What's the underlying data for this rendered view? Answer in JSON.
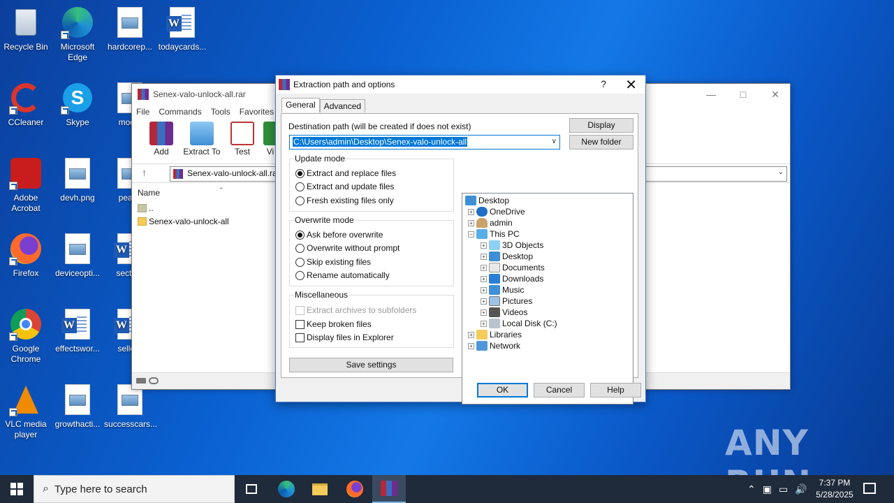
{
  "desktop": {
    "icons": [
      {
        "label": "Recycle Bin"
      },
      {
        "label": "Microsoft Edge"
      },
      {
        "label": "hardcorep..."
      },
      {
        "label": "todaycards..."
      },
      {
        "label": "CCleaner"
      },
      {
        "label": "Skype"
      },
      {
        "label": "modul"
      },
      {
        "label": "Adobe Acrobat"
      },
      {
        "label": "devh.png"
      },
      {
        "label": "peace"
      },
      {
        "label": "Firefox"
      },
      {
        "label": "deviceopti..."
      },
      {
        "label": "sectore"
      },
      {
        "label": "Google Chrome"
      },
      {
        "label": "effectswor..."
      },
      {
        "label": "sellera"
      },
      {
        "label": "VLC media player"
      },
      {
        "label": "growthacti..."
      },
      {
        "label": "successcars..."
      }
    ]
  },
  "winrar": {
    "title": "Senex-valo-unlock-all.rar",
    "menu": [
      "File",
      "Commands",
      "Tools",
      "Favorites"
    ],
    "toolbar": [
      "Add",
      "Extract To",
      "Test",
      "Vi"
    ],
    "address": "Senex-valo-unlock-all.ra",
    "column_name": "Name",
    "rows": [
      "..",
      "Senex-valo-unlock-all"
    ]
  },
  "dialog": {
    "title": "Extraction path and options",
    "help": "?",
    "close": "✕",
    "tabs": [
      "General",
      "Advanced"
    ],
    "dest_label": "Destination path (will be created if does not exist)",
    "dest_value": "C:\\Users\\admin\\Desktop\\Senex-valo-unlock-all",
    "display_btn": "Display",
    "new_folder_btn": "New folder",
    "update_mode": {
      "title": "Update mode",
      "options": [
        "Extract and replace files",
        "Extract and update files",
        "Fresh existing files only"
      ],
      "selected": 0
    },
    "overwrite_mode": {
      "title": "Overwrite mode",
      "options": [
        "Ask before overwrite",
        "Overwrite without prompt",
        "Skip existing files",
        "Rename automatically"
      ],
      "selected": 0
    },
    "misc": {
      "title": "Miscellaneous",
      "options": [
        "Extract archives to subfolders",
        "Keep broken files",
        "Display files in Explorer"
      ]
    },
    "save_settings": "Save settings",
    "tree": [
      "Desktop",
      "OneDrive",
      "admin",
      "This PC",
      "3D Objects",
      "Desktop",
      "Documents",
      "Downloads",
      "Music",
      "Pictures",
      "Videos",
      "Local Disk (C:)",
      "Libraries",
      "Network"
    ],
    "ok": "OK",
    "cancel": "Cancel",
    "help_btn": "Help"
  },
  "taskbar": {
    "search_placeholder": "Type here to search",
    "time": "7:37 PM",
    "date": "5/28/2025"
  },
  "watermark": "ANY RUN"
}
